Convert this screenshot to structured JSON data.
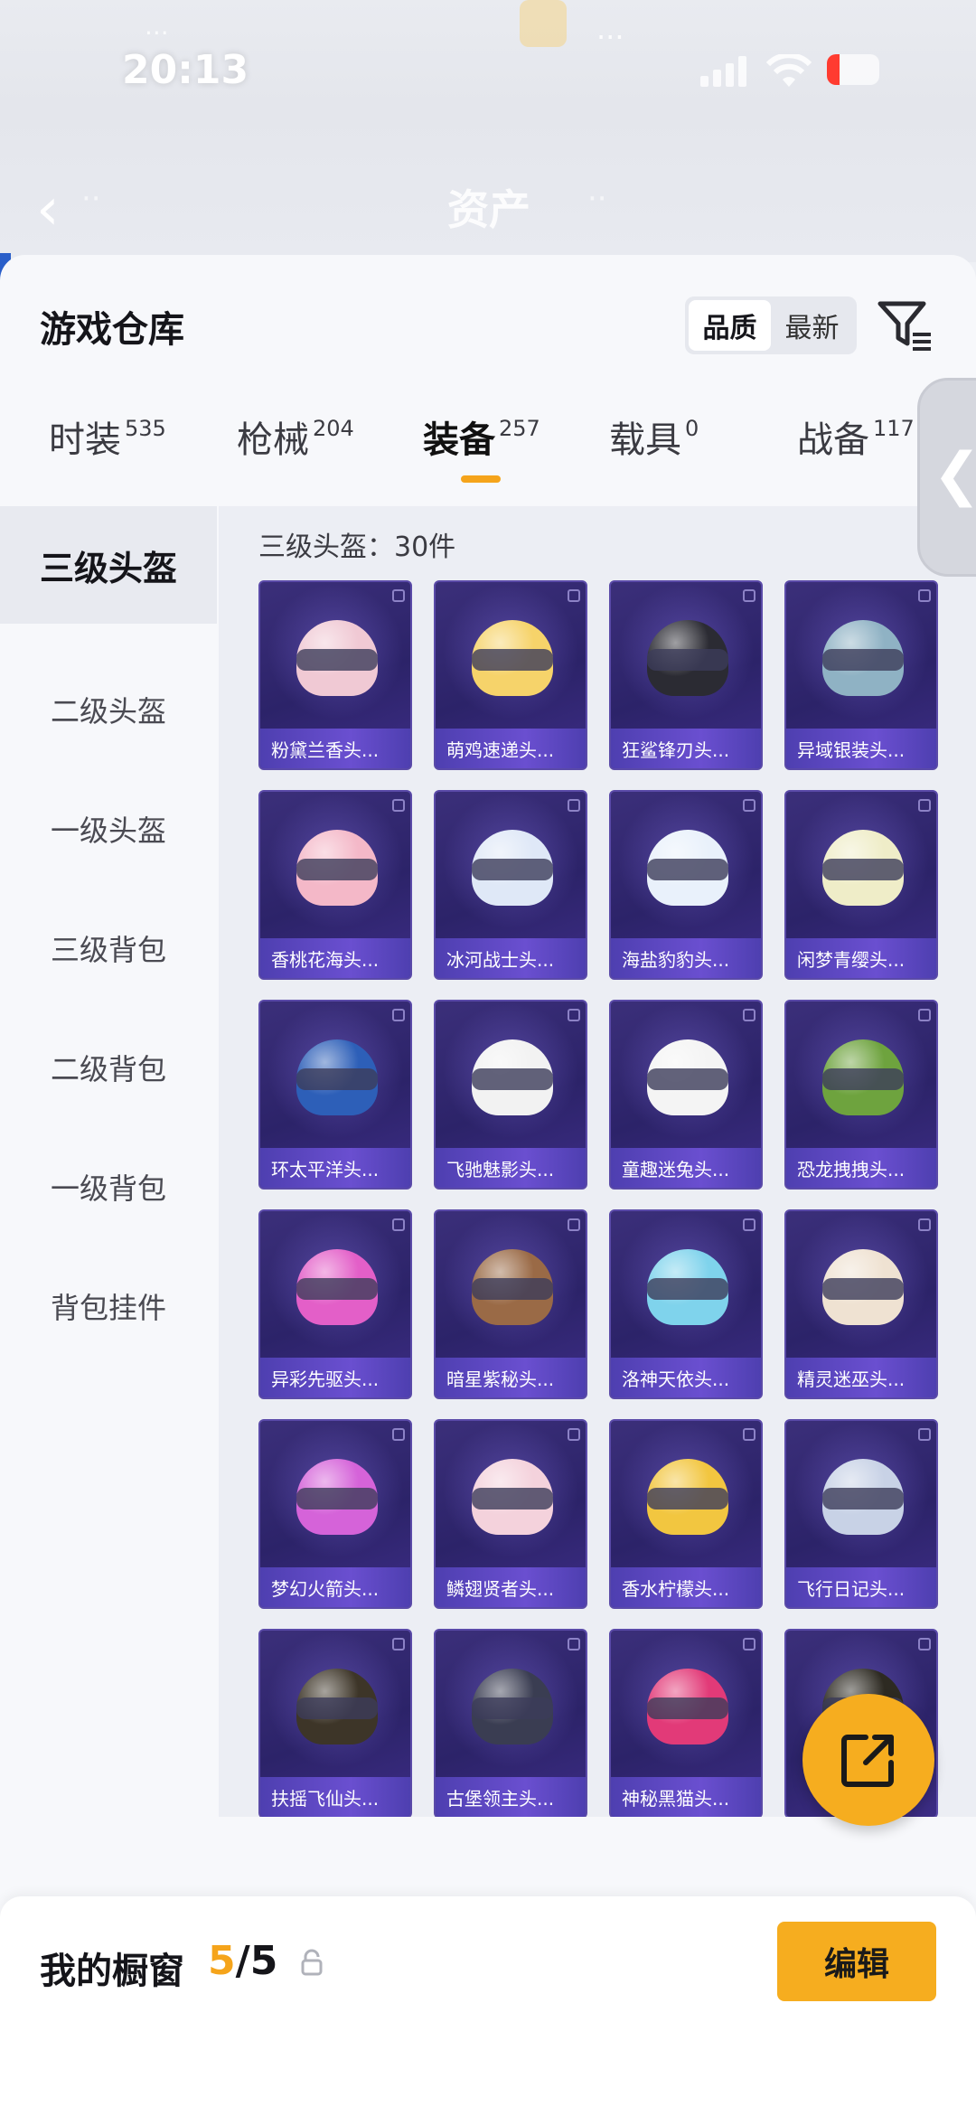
{
  "status_bar": {
    "time": "20:13",
    "notification": "···",
    "center_text": "···"
  },
  "header": {
    "title": "资产",
    "left_text": "··",
    "right_text": "··"
  },
  "warehouse": {
    "title": "游戏仓库",
    "sort": {
      "options": [
        "品质",
        "最新"
      ],
      "selected": "品质"
    }
  },
  "tabs": [
    {
      "label": "时装",
      "count": "535"
    },
    {
      "label": "枪械",
      "count": "204"
    },
    {
      "label": "装备",
      "count": "257"
    },
    {
      "label": "载具",
      "count": "0"
    },
    {
      "label": "战备",
      "count": "117"
    }
  ],
  "active_tab": "装备",
  "sub_nav": [
    "三级头盔",
    "二级头盔",
    "一级头盔",
    "三级背包",
    "二级背包",
    "一级背包",
    "背包挂件"
  ],
  "active_sub": "三级头盔",
  "grid_header": "三级头盔：30件",
  "items": [
    {
      "name": "粉黛兰香头...",
      "color": "#f0c9d4"
    },
    {
      "name": "萌鸡速递头...",
      "color": "#f6d36a"
    },
    {
      "name": "狂鲨锋刃头...",
      "color": "#2b2b33"
    },
    {
      "name": "异域银装头...",
      "color": "#8fb2c4"
    },
    {
      "name": "香桃花海头...",
      "color": "#f4b8c8"
    },
    {
      "name": "冰河战士头...",
      "color": "#dfe8f7"
    },
    {
      "name": "海盐豹豹头...",
      "color": "#e9f1fb"
    },
    {
      "name": "闲梦青缨头...",
      "color": "#efedc8"
    },
    {
      "name": "环太平洋头...",
      "color": "#2d5fb8"
    },
    {
      "name": "飞驰魅影头...",
      "color": "#f2f2f2"
    },
    {
      "name": "童趣迷兔头...",
      "color": "#f4f4f4"
    },
    {
      "name": "恐龙拽拽头...",
      "color": "#6ea33e"
    },
    {
      "name": "异彩先驱头...",
      "color": "#e35fc8"
    },
    {
      "name": "暗星紫秘头...",
      "color": "#9a6a46"
    },
    {
      "name": "洛神天依头...",
      "color": "#7fd3ec"
    },
    {
      "name": "精灵迷巫头...",
      "color": "#efe2d2"
    },
    {
      "name": "梦幻火箭头...",
      "color": "#d563d9"
    },
    {
      "name": "鳞翅贤者头...",
      "color": "#f4d2dc"
    },
    {
      "name": "香水柠檬头...",
      "color": "#f2c640"
    },
    {
      "name": "飞行日记头...",
      "color": "#c8d2e6"
    },
    {
      "name": "扶摇飞仙头...",
      "color": "#3d3528"
    },
    {
      "name": "古堡领主头...",
      "color": "#3a3d52"
    },
    {
      "name": "神秘黑猫头...",
      "color": "#e23a78"
    },
    {
      "name": "",
      "color": "#2d2a22"
    },
    {
      "name": "",
      "color": "#5a4a30"
    },
    {
      "name": "",
      "color": "#7a4ec8"
    },
    {
      "name": "",
      "color": "#cfd2d8"
    },
    {
      "name": "",
      "color": "#2a2a30"
    }
  ],
  "showcase": {
    "title": "我的橱窗",
    "current": "5",
    "total": "/5",
    "edit_label": "编辑"
  },
  "colors": {
    "accent": "#f5a41b",
    "card_bg": "#2f2570"
  }
}
